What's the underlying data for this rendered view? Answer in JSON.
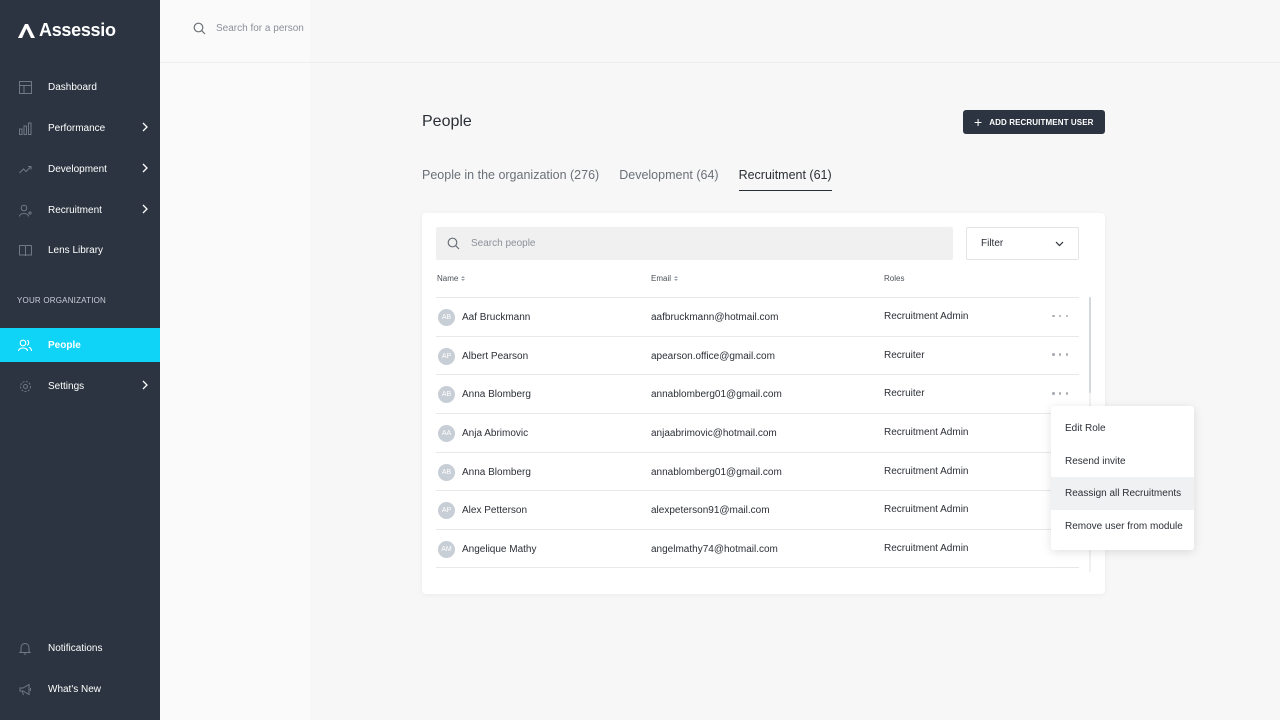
{
  "app": {
    "name": "Assessio"
  },
  "sidebar": {
    "items": [
      {
        "label": "Dashboard",
        "icon": "dashboard-icon"
      },
      {
        "label": "Performance",
        "icon": "bar-chart-icon"
      },
      {
        "label": "Development",
        "icon": "trend-icon"
      },
      {
        "label": "Recruitment",
        "icon": "add-user-icon"
      },
      {
        "label": "Lens Library",
        "icon": "book-icon"
      }
    ],
    "section_label": "YOUR ORGANIZATION",
    "org_items": [
      {
        "label": "People",
        "icon": "people-icon"
      },
      {
        "label": "Settings",
        "icon": "gear-icon"
      }
    ],
    "bottom_items": [
      {
        "label": "Notifications",
        "icon": "bell-icon"
      },
      {
        "label": "What's New",
        "icon": "megaphone-icon"
      }
    ],
    "active_color": "#0fd4f7",
    "background": "#2b3440"
  },
  "top_search": {
    "placeholder": "Search for a person"
  },
  "page": {
    "title": "People",
    "add_button": "ADD RECRUITMENT USER",
    "tabs": [
      {
        "label": "People in the organization (276)"
      },
      {
        "label": "Development (64)"
      },
      {
        "label": "Recruitment (61)"
      }
    ],
    "active_tab": "Recruitment (61)"
  },
  "table": {
    "search_placeholder": "Search people",
    "filter_label": "Filter",
    "columns": [
      "Name",
      "Email",
      "Roles"
    ],
    "rows": [
      {
        "initials": "AB",
        "name": "Aaf Bruckmann",
        "email": "aafbruckmann@hotmail.com",
        "role": "Recruitment Admin"
      },
      {
        "initials": "AP",
        "name": "Albert Pearson",
        "email": "apearson.office@gmail.com",
        "role": "Recruiter"
      },
      {
        "initials": "AB",
        "name": "Anna Blomberg",
        "email": "annablomberg01@gmail.com",
        "role": "Recruiter"
      },
      {
        "initials": "AA",
        "name": "Anja Abrimovic",
        "email": "anjaabrimovic@hotmail.com",
        "role": "Recruitment Admin"
      },
      {
        "initials": "AB",
        "name": "Anna Blomberg",
        "email": "annablomberg01@gmail.com",
        "role": "Recruitment Admin"
      },
      {
        "initials": "AP",
        "name": "Alex Petterson",
        "email": "alexpeterson91@mail.com",
        "role": "Recruitment Admin"
      },
      {
        "initials": "AM",
        "name": "Angelique Mathy",
        "email": "angelmathy74@hotmail.com",
        "role": "Recruitment Admin"
      }
    ]
  },
  "context_menu": {
    "items": [
      "Edit Role",
      "Resend invite",
      "Reassign all Recruitments",
      "Remove user from module"
    ],
    "hovered": "Reassign all Recruitments"
  }
}
